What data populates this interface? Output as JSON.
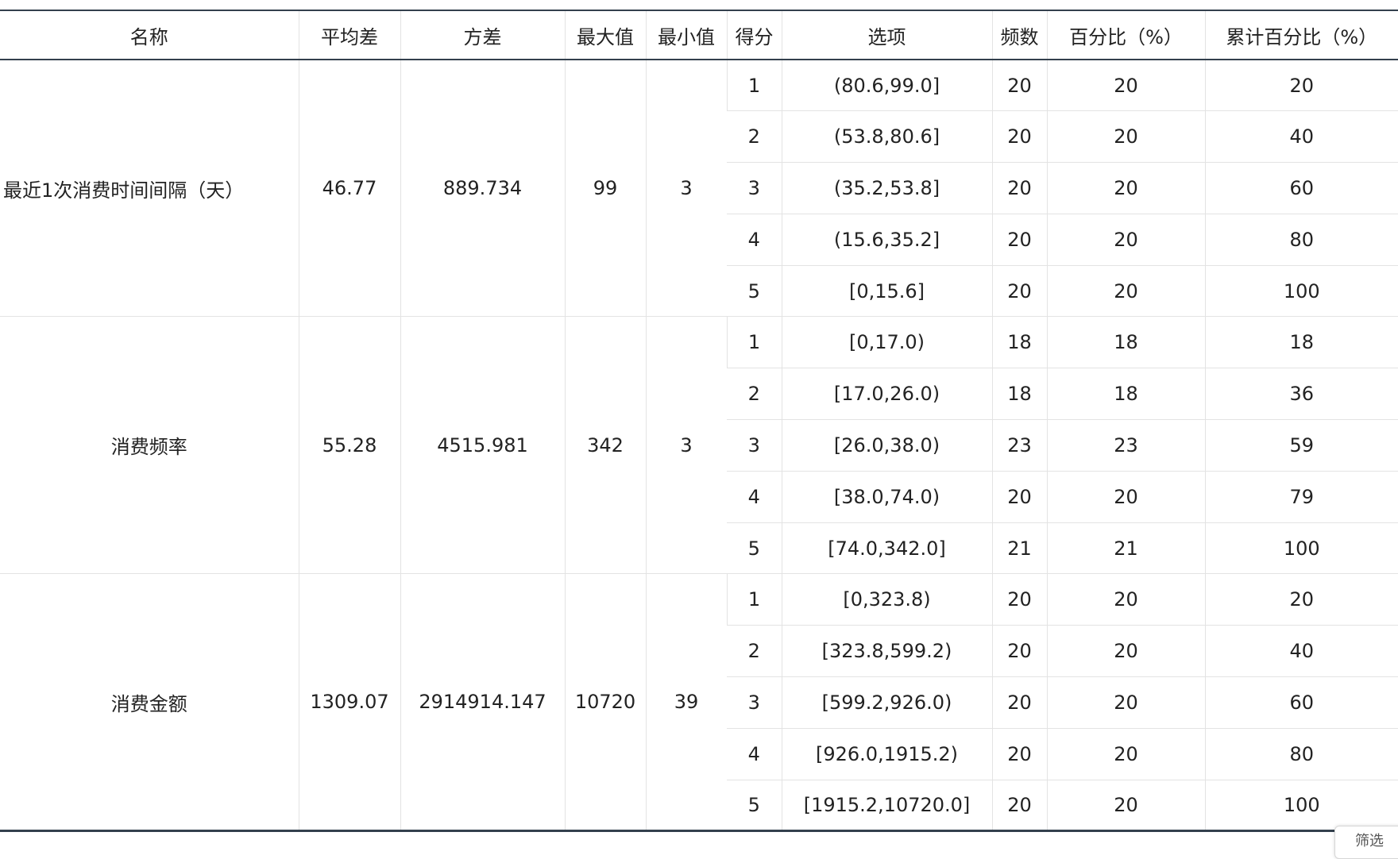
{
  "headers": [
    "名称",
    "平均差",
    "方差",
    "最大值",
    "最小值",
    "得分",
    "选项",
    "频数",
    "百分比（%）",
    "累计百分比（%）"
  ],
  "groups": [
    {
      "name": "最近1次消费时间间隔（天）",
      "mean_diff": "46.77",
      "variance": "889.734",
      "max": "99",
      "min": "3",
      "rows": [
        {
          "score": "1",
          "option": "(80.6,99.0]",
          "freq": "20",
          "pct": "20",
          "cum": "20"
        },
        {
          "score": "2",
          "option": "(53.8,80.6]",
          "freq": "20",
          "pct": "20",
          "cum": "40"
        },
        {
          "score": "3",
          "option": "(35.2,53.8]",
          "freq": "20",
          "pct": "20",
          "cum": "60"
        },
        {
          "score": "4",
          "option": "(15.6,35.2]",
          "freq": "20",
          "pct": "20",
          "cum": "80"
        },
        {
          "score": "5",
          "option": "[0,15.6]",
          "freq": "20",
          "pct": "20",
          "cum": "100"
        }
      ]
    },
    {
      "name": "消费频率",
      "mean_diff": "55.28",
      "variance": "4515.981",
      "max": "342",
      "min": "3",
      "rows": [
        {
          "score": "1",
          "option": "[0,17.0)",
          "freq": "18",
          "pct": "18",
          "cum": "18"
        },
        {
          "score": "2",
          "option": "[17.0,26.0)",
          "freq": "18",
          "pct": "18",
          "cum": "36"
        },
        {
          "score": "3",
          "option": "[26.0,38.0)",
          "freq": "23",
          "pct": "23",
          "cum": "59"
        },
        {
          "score": "4",
          "option": "[38.0,74.0)",
          "freq": "20",
          "pct": "20",
          "cum": "79"
        },
        {
          "score": "5",
          "option": "[74.0,342.0]",
          "freq": "21",
          "pct": "21",
          "cum": "100"
        }
      ]
    },
    {
      "name": "消费金额",
      "mean_diff": "1309.07",
      "variance": "2914914.147",
      "max": "10720",
      "min": "39",
      "rows": [
        {
          "score": "1",
          "option": "[0,323.8)",
          "freq": "20",
          "pct": "20",
          "cum": "20"
        },
        {
          "score": "2",
          "option": "[323.8,599.2)",
          "freq": "20",
          "pct": "20",
          "cum": "40"
        },
        {
          "score": "3",
          "option": "[599.2,926.0)",
          "freq": "20",
          "pct": "20",
          "cum": "60"
        },
        {
          "score": "4",
          "option": "[926.0,1915.2)",
          "freq": "20",
          "pct": "20",
          "cum": "80"
        },
        {
          "score": "5",
          "option": "[1915.2,10720.0]",
          "freq": "20",
          "pct": "20",
          "cum": "100"
        }
      ]
    }
  ],
  "filter_tab_label": "筛选"
}
